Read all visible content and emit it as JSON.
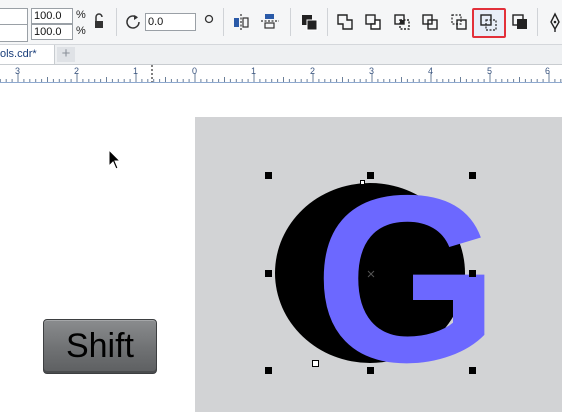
{
  "toolbar": {
    "scale_width_value": "100.0",
    "scale_height_value": "100.0",
    "percent_symbol": "%",
    "rotation_value": "0.0",
    "highlighted_tool": "Simplify",
    "highlight_color": "#e2303a"
  },
  "tabs": {
    "document_tab_label": "ols.cdr*",
    "new_tab_symbol": "+"
  },
  "ruler": {
    "labels": [
      "3",
      "2",
      "1",
      "0",
      "1",
      "2",
      "3",
      "4",
      "5",
      "6"
    ]
  },
  "canvas": {
    "letter": "G",
    "letter_color": "#6c68ff",
    "circle_color": "#000000",
    "page_color": "#d2d3d5"
  },
  "shift_key": {
    "label": "Shift"
  }
}
